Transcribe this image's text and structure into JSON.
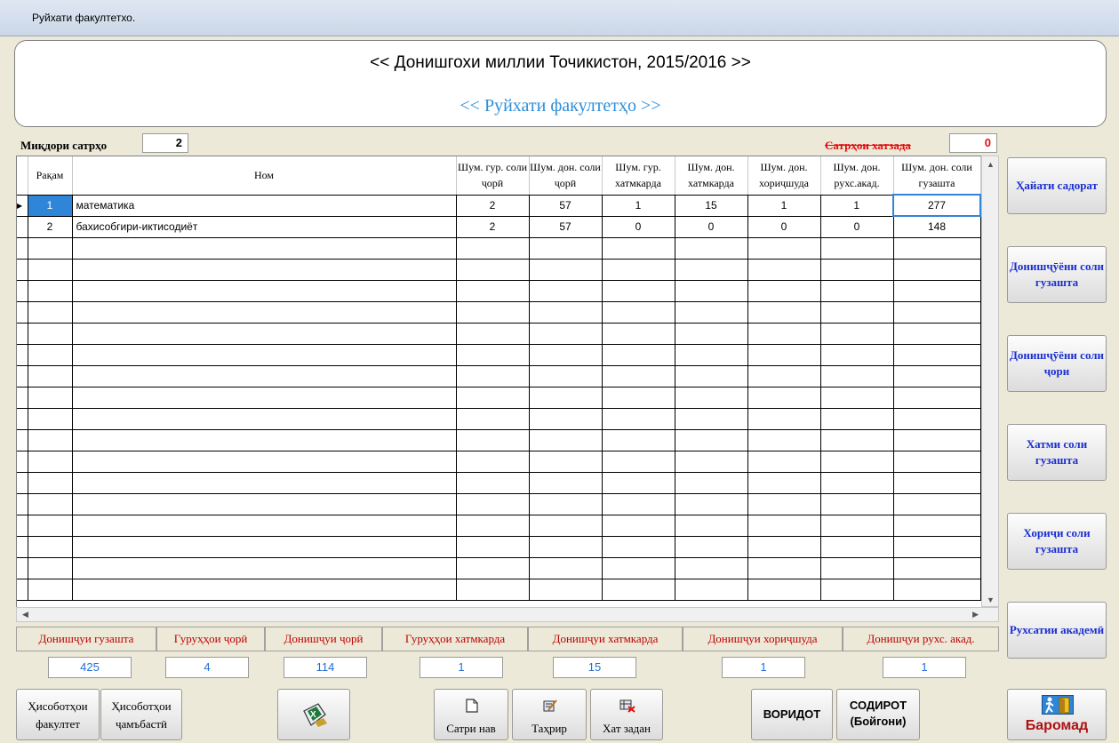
{
  "window": {
    "title": "Руйхати факултетхо."
  },
  "header": {
    "university": "<< Донишгохи миллии Точикистон, 2015/2016 >>",
    "subtitle": "<< Руйхати факултетҳо >>"
  },
  "counters": {
    "rows_label": "Миқдори сатрҳо",
    "rows_value": "2",
    "errors_label": "Сатрҳои хатзада",
    "errors_value": "0"
  },
  "table": {
    "columns": [
      "Рақам",
      "Ном",
      "Шум. гур. соли ҷорӣ",
      "Шум. дон. соли ҷорӣ",
      "Шум. гур. хатмкарда",
      "Шум. дон. хатмкарда",
      "Шум. дон. хориҷшуда",
      "Шум. дон. рухс.акад.",
      "Шум. дон. соли гузашта"
    ],
    "rows": [
      [
        "1",
        "математика",
        "2",
        "57",
        "1",
        "15",
        "1",
        "1",
        "277"
      ],
      [
        "2",
        "бахисобгири-иктисодиёт",
        "2",
        "57",
        "0",
        "0",
        "0",
        "0",
        "148"
      ]
    ]
  },
  "summary": {
    "labels": [
      "Донишҷуи гузашта",
      "Гуруҳҳои ҷорӣ",
      "Донишҷуи ҷорӣ",
      "Гуруҳҳои хатмкарда",
      "Донишҷуи хатмкарда",
      "Донишҷуи хориҷшуда",
      "Донишҷуи рухс. акад."
    ],
    "values": [
      "425",
      "4",
      "114",
      "1",
      "15",
      "1",
      "1"
    ]
  },
  "side_buttons": [
    "Ҳайати садорат",
    "Донишҷӯёни соли гузашта",
    "Донишҷӯёни соли ҷори",
    "Хатми соли гузашта",
    "Хориҷи соли гузашта",
    "Рухсатии академӣ"
  ],
  "bottom_buttons": {
    "report_faculty": "Ҳисоботҳои факултет",
    "report_total": "Ҳисоботҳои ҷамъбастӣ",
    "new_row": "Сатри нав",
    "edit": "Таҳрир",
    "delete": "Хат задан",
    "incoming": "ВОРИДОТ",
    "outgoing": "СОДИРОТ (Бойгони)",
    "exit": "Баромад"
  }
}
